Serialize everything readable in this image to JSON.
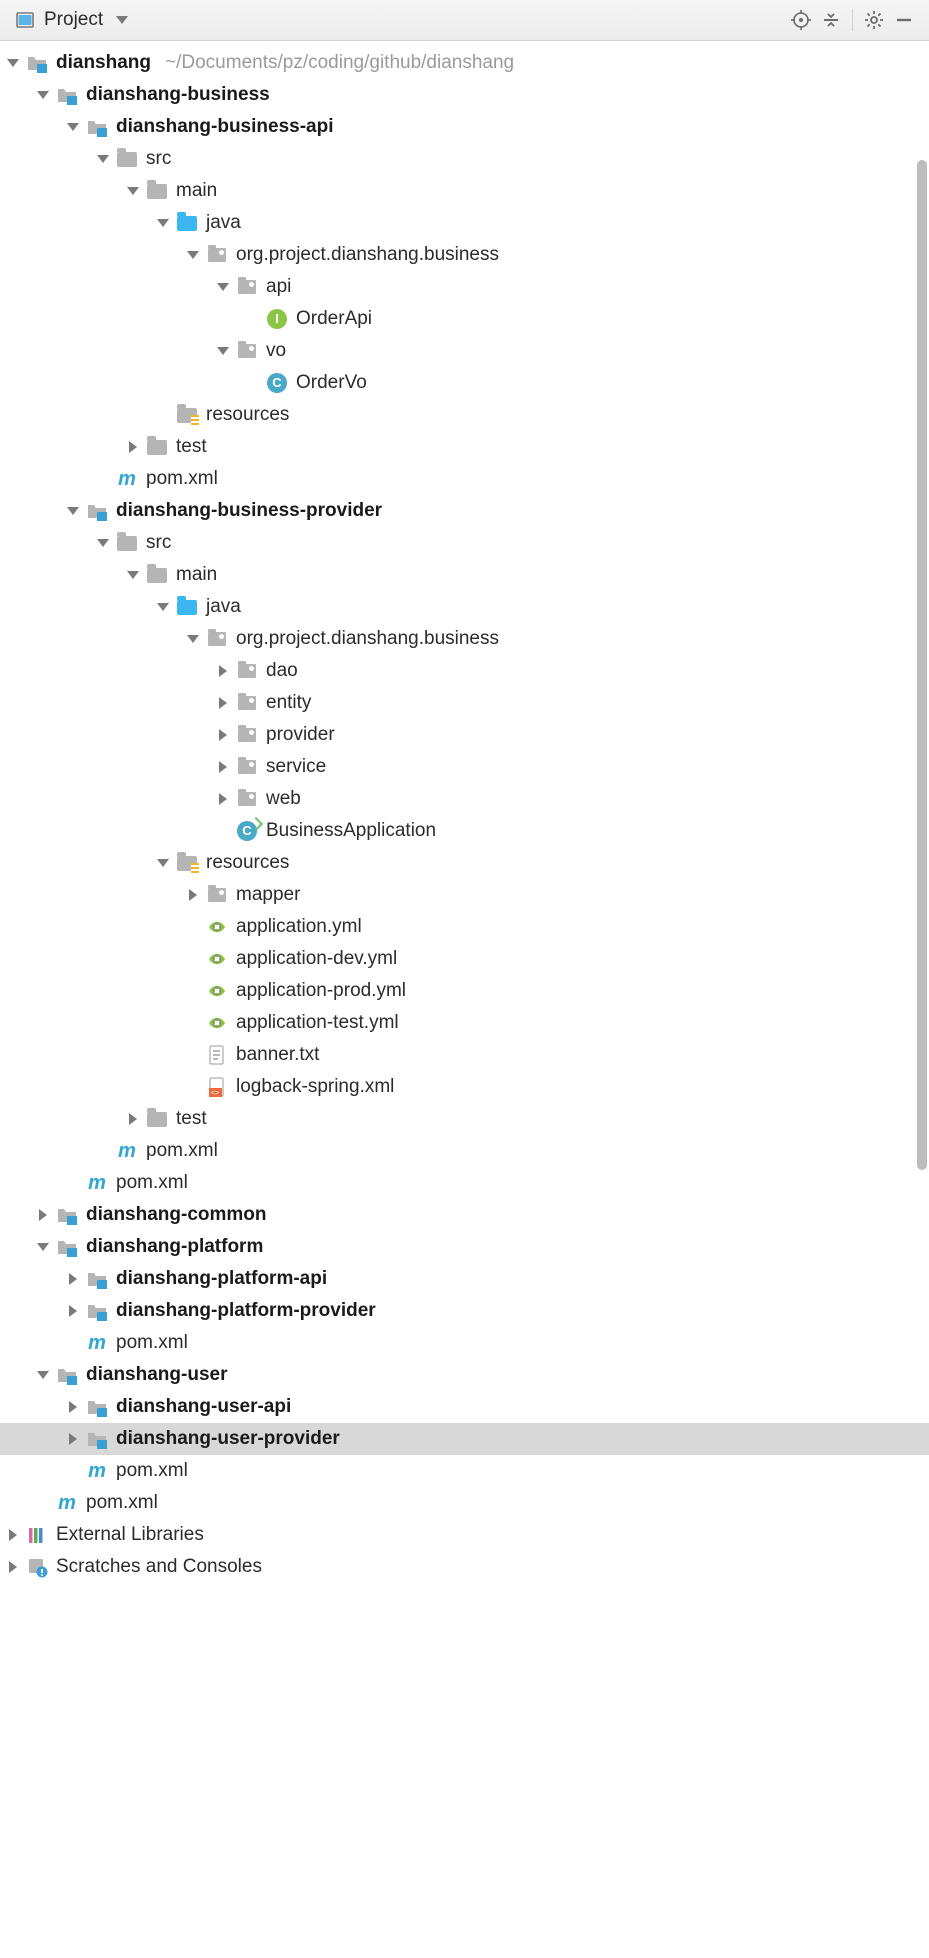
{
  "header": {
    "title": "Project"
  },
  "root_path_hint": "~/Documents/pz/coding/github/dianshang",
  "tree": [
    {
      "d": 0,
      "arrow": "down",
      "icon": "module",
      "bold": true,
      "label": "dianshang",
      "suffix_gray": "~/Documents/pz/coding/github/dianshang"
    },
    {
      "d": 1,
      "arrow": "down",
      "icon": "module",
      "bold": true,
      "label": "dianshang-business"
    },
    {
      "d": 2,
      "arrow": "down",
      "icon": "module",
      "bold": true,
      "label": "dianshang-business-api"
    },
    {
      "d": 3,
      "arrow": "down",
      "icon": "folder",
      "label": "src"
    },
    {
      "d": 4,
      "arrow": "down",
      "icon": "folder",
      "label": "main"
    },
    {
      "d": 5,
      "arrow": "down",
      "icon": "folder-src",
      "label": "java"
    },
    {
      "d": 6,
      "arrow": "down",
      "icon": "package",
      "label": "org.project.dianshang.business"
    },
    {
      "d": 7,
      "arrow": "down",
      "icon": "package",
      "label": "api"
    },
    {
      "d": 8,
      "arrow": "none",
      "icon": "interface",
      "label": "OrderApi"
    },
    {
      "d": 7,
      "arrow": "down",
      "icon": "package",
      "label": "vo"
    },
    {
      "d": 8,
      "arrow": "none",
      "icon": "class",
      "label": "OrderVo"
    },
    {
      "d": 5,
      "arrow": "none",
      "icon": "folder-res",
      "label": "resources"
    },
    {
      "d": 4,
      "arrow": "right",
      "icon": "folder",
      "label": "test"
    },
    {
      "d": 3,
      "arrow": "none",
      "icon": "pom",
      "label": "pom.xml"
    },
    {
      "d": 2,
      "arrow": "down",
      "icon": "module",
      "bold": true,
      "label": "dianshang-business-provider"
    },
    {
      "d": 3,
      "arrow": "down",
      "icon": "folder",
      "label": "src"
    },
    {
      "d": 4,
      "arrow": "down",
      "icon": "folder",
      "label": "main"
    },
    {
      "d": 5,
      "arrow": "down",
      "icon": "folder-src",
      "label": "java"
    },
    {
      "d": 6,
      "arrow": "down",
      "icon": "package",
      "label": "org.project.dianshang.business"
    },
    {
      "d": 7,
      "arrow": "right",
      "icon": "package",
      "label": "dao"
    },
    {
      "d": 7,
      "arrow": "right",
      "icon": "package",
      "label": "entity"
    },
    {
      "d": 7,
      "arrow": "right",
      "icon": "package",
      "label": "provider"
    },
    {
      "d": 7,
      "arrow": "right",
      "icon": "package",
      "label": "service"
    },
    {
      "d": 7,
      "arrow": "right",
      "icon": "package",
      "label": "web"
    },
    {
      "d": 7,
      "arrow": "none",
      "icon": "spring-class",
      "label": "BusinessApplication"
    },
    {
      "d": 5,
      "arrow": "down",
      "icon": "folder-res",
      "label": "resources"
    },
    {
      "d": 6,
      "arrow": "right",
      "icon": "package",
      "label": "mapper"
    },
    {
      "d": 6,
      "arrow": "none",
      "icon": "yml",
      "label": "application.yml"
    },
    {
      "d": 6,
      "arrow": "none",
      "icon": "yml",
      "label": "application-dev.yml"
    },
    {
      "d": 6,
      "arrow": "none",
      "icon": "yml",
      "label": "application-prod.yml"
    },
    {
      "d": 6,
      "arrow": "none",
      "icon": "yml",
      "label": "application-test.yml"
    },
    {
      "d": 6,
      "arrow": "none",
      "icon": "txt",
      "label": "banner.txt"
    },
    {
      "d": 6,
      "arrow": "none",
      "icon": "xml",
      "label": "logback-spring.xml"
    },
    {
      "d": 4,
      "arrow": "right",
      "icon": "folder",
      "label": "test"
    },
    {
      "d": 3,
      "arrow": "none",
      "icon": "pom",
      "label": "pom.xml"
    },
    {
      "d": 2,
      "arrow": "none",
      "icon": "pom",
      "label": "pom.xml"
    },
    {
      "d": 1,
      "arrow": "right",
      "icon": "module",
      "bold": true,
      "label": "dianshang-common"
    },
    {
      "d": 1,
      "arrow": "down",
      "icon": "module",
      "bold": true,
      "label": "dianshang-platform"
    },
    {
      "d": 2,
      "arrow": "right",
      "icon": "module",
      "bold": true,
      "label": "dianshang-platform-api"
    },
    {
      "d": 2,
      "arrow": "right",
      "icon": "module",
      "bold": true,
      "label": "dianshang-platform-provider"
    },
    {
      "d": 2,
      "arrow": "none",
      "icon": "pom",
      "label": "pom.xml"
    },
    {
      "d": 1,
      "arrow": "down",
      "icon": "module",
      "bold": true,
      "label": "dianshang-user"
    },
    {
      "d": 2,
      "arrow": "right",
      "icon": "module",
      "bold": true,
      "label": "dianshang-user-api"
    },
    {
      "d": 2,
      "arrow": "right",
      "icon": "module",
      "bold": true,
      "label": "dianshang-user-provider",
      "selected": true
    },
    {
      "d": 2,
      "arrow": "none",
      "icon": "pom",
      "label": "pom.xml"
    },
    {
      "d": 1,
      "arrow": "none",
      "icon": "pom",
      "label": "pom.xml"
    },
    {
      "d": 0,
      "arrow": "right",
      "icon": "libraries",
      "label": "External Libraries"
    },
    {
      "d": 0,
      "arrow": "right",
      "icon": "scratches",
      "label": "Scratches and Consoles"
    }
  ]
}
